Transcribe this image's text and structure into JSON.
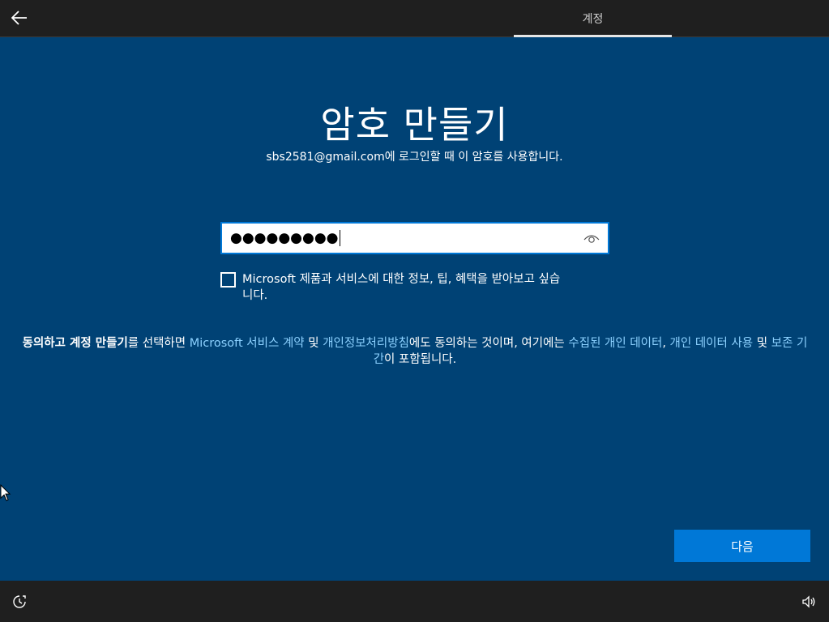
{
  "header": {
    "back_icon": "back-arrow-icon",
    "tab_label": "계정"
  },
  "main": {
    "title": "암호 만들기",
    "subtitle": "sbs2581@gmail.com에 로그인할 때 이 암호를 사용합니다.",
    "password": {
      "value": "●●●●●●●●●",
      "reveal_icon": "eye-icon"
    },
    "checkbox": {
      "checked": false,
      "label_line1": "Microsoft 제품과 서비스에 대한 정보, 팁, 혜택을 받아보고 싶습",
      "label_line2": "니다."
    },
    "legal": {
      "p1_bold": "동의하고 계정 만들기",
      "p2": "를 선택하면 ",
      "link_microsoft": "Microsoft",
      "link_service_agreement": " 서비스 계약",
      "p3": " 및 ",
      "link_privacy": "개인정보처리방침",
      "p4": "에도 동의하는 것이며, 여기에는 ",
      "link_collected": "수집된 개인 데이터",
      "p5": ", ",
      "link_usage": "개인 데이터 사용",
      "p6": " 및 ",
      "link_retention": "보존 기간",
      "p7": "이 포함됩니다."
    },
    "next_button": "다음"
  },
  "footer": {
    "ease_icon": "ease-of-access-icon",
    "volume_icon": "volume-icon"
  },
  "colors": {
    "background": "#004275",
    "bar": "#1f1f1f",
    "accent": "#0078d7",
    "link": "#8cd1ff"
  }
}
